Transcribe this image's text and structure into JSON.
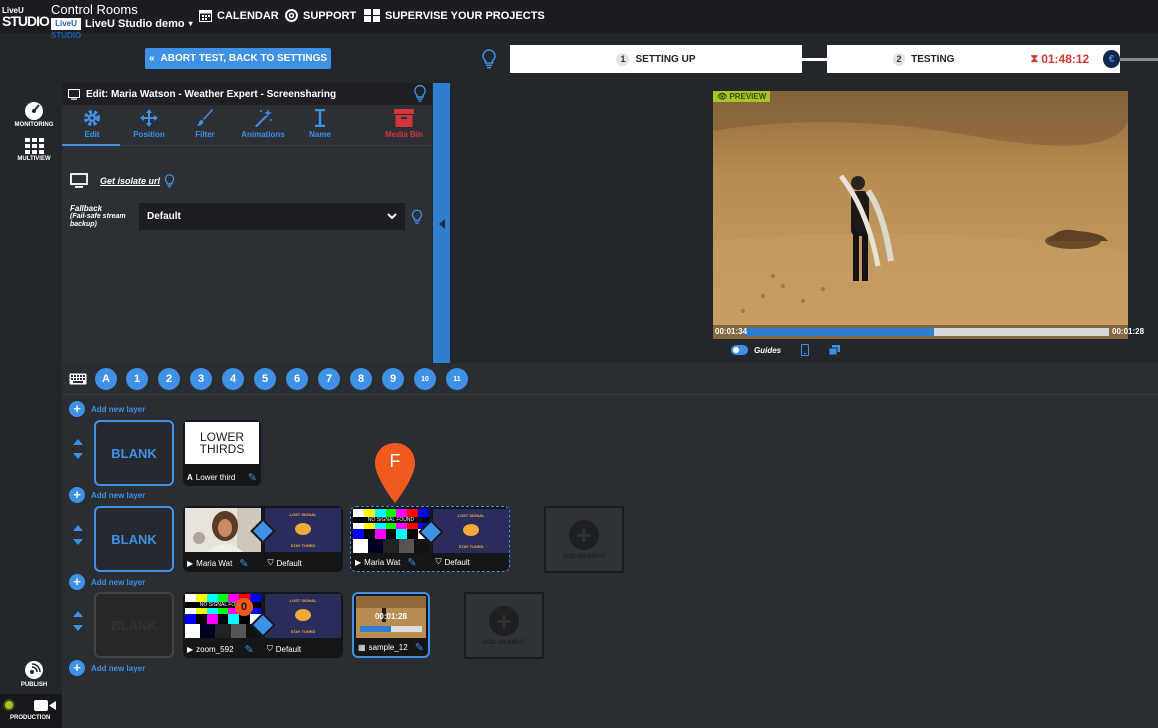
{
  "brand": {
    "logo_top": "LiveU",
    "logo_bottom": "STUDIO"
  },
  "control": {
    "title": "Control Rooms",
    "studio": "LiveU Studio demo",
    "mini_logo": "LiveU STUDIO"
  },
  "nav": {
    "calendar": "CALENDAR",
    "support": "SUPPORT",
    "supervise": "SUPERVISE YOUR PROJECTS"
  },
  "abort_button": "ABORT TEST, BACK TO SETTINGS",
  "steps": [
    {
      "num": "1",
      "label": "SETTING UP"
    },
    {
      "num": "2",
      "label": "TESTING"
    }
  ],
  "timer": "01:48:12",
  "currency_icon": "€",
  "sidebar": {
    "monitoring": "MONITORING",
    "multiview": "MULTIVIEW",
    "publish": "PUBLISH",
    "production": "PRODUCTION"
  },
  "edit": {
    "title": "Edit: Maria Watson - Weather Expert - Screensharing",
    "tools": [
      "Edit",
      "Position",
      "Filter",
      "Animations",
      "Name",
      "Media Bin"
    ],
    "isolate_link": "Get isolate url",
    "fallback_label_1": "Fallback",
    "fallback_label_2": "(Fail-safe stream backup)",
    "fallback_value": "Default"
  },
  "preview": {
    "tag": "PREVIEW",
    "time_left": "00:01:34",
    "time_right": "00:01:28",
    "progress": 0.52,
    "guides": "Guides"
  },
  "scenes": [
    "A",
    "1",
    "2",
    "3",
    "4",
    "5",
    "6",
    "7",
    "8",
    "9",
    "10",
    "11"
  ],
  "layers": {
    "add_label": "Add new layer",
    "blank": "BLANK",
    "lower_thirds_thumb_1": "LOWER",
    "lower_thirds_thumb_2": "THIRDS",
    "lower_thirds_label": "Lower third",
    "maria_label": "Maria Wat",
    "default_label": "Default",
    "zoom_label": "zoom_592",
    "sample_label": "sample_12",
    "sample_time": "00:01:28",
    "add_input": "ADD AN INPUT",
    "lost_signal": "LOST SIGNAL",
    "stay_tuned": "STAY TUNED",
    "no_signal": "NO SIGNAL FOUND",
    "marker": "F",
    "badge": "0"
  },
  "colors": {
    "accent": "#3f91e6",
    "danger": "#d23a2c",
    "preview_tag": "#a6c627"
  }
}
